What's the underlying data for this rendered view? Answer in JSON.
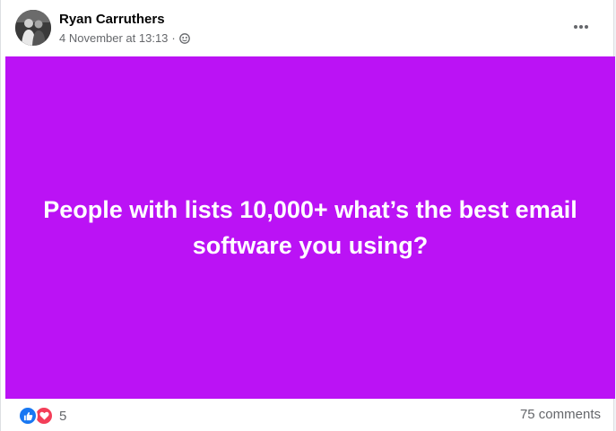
{
  "post": {
    "author": "Ryan Carruthers",
    "timestamp": "4 November at 13:13",
    "separator": "·",
    "audience_icon": "public-globe-icon",
    "more_icon": "more-options-icon",
    "text": "People with lists 10,000+ what’s the best email software you using?",
    "background_color": "#bb12f5",
    "reactions": {
      "icons": [
        "like-icon",
        "love-icon"
      ],
      "count": "5"
    },
    "comments": "75 comments"
  }
}
